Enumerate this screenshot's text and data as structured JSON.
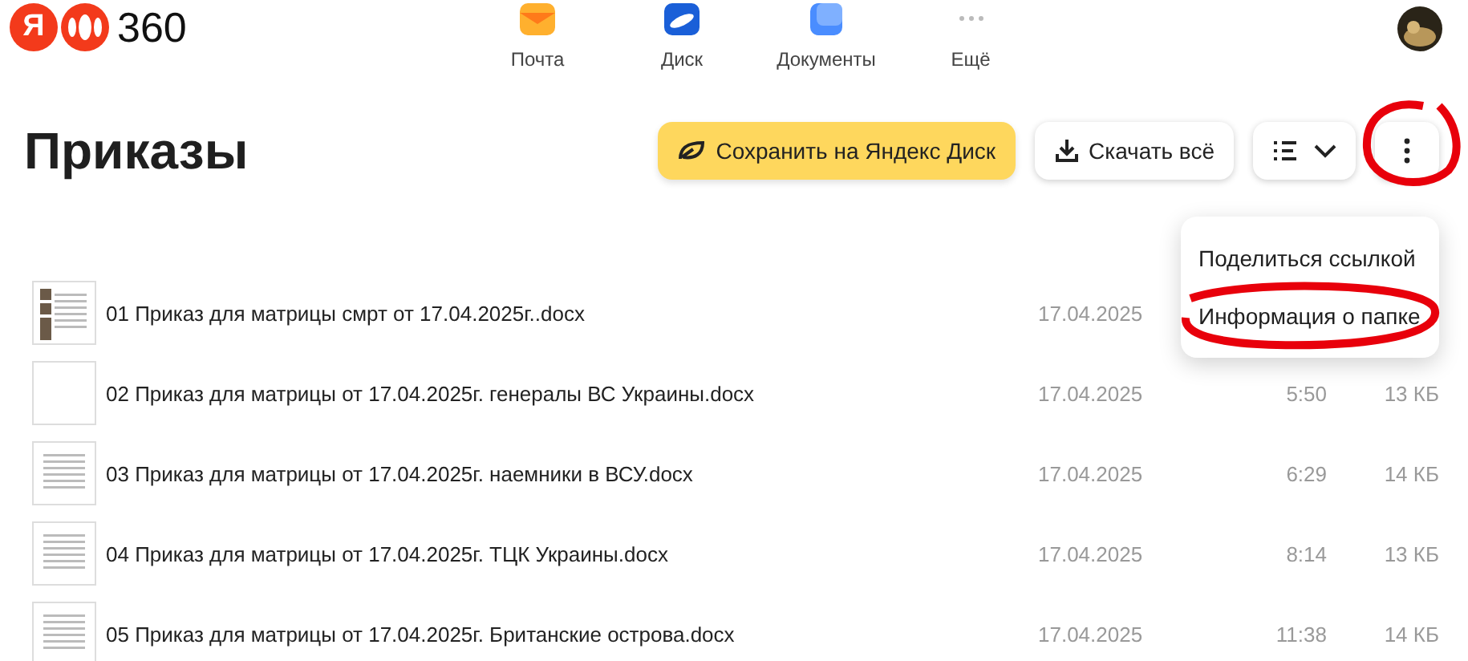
{
  "header": {
    "logo": {
      "letter": "Я",
      "name": "360"
    },
    "apps": [
      {
        "kind": "mail",
        "label": "Почта"
      },
      {
        "kind": "disk",
        "label": "Диск"
      },
      {
        "kind": "docs",
        "label": "Документы"
      },
      {
        "kind": "more",
        "label": "Ещё"
      }
    ]
  },
  "title": "Приказы",
  "toolbar": {
    "save_label": "Сохранить на Яндекс Диск",
    "download_label": "Скачать всё",
    "more_circled": true
  },
  "more_menu": {
    "open": true,
    "items": [
      {
        "label": "Поделиться ссылкой",
        "circled": false
      },
      {
        "label": "Информация о папке",
        "circled": true
      }
    ]
  },
  "files": [
    {
      "name": "01 Приказ для матрицы смрт от 17.04.2025г..docx",
      "date": "17.04.2025",
      "kind": "photos"
    },
    {
      "name": "02 Приказ для матрицы от 17.04.2025г. генералы ВС Украины.docx",
      "date": "17.04.2025",
      "time": "5:50",
      "size": "13 КБ",
      "kind": "blank"
    },
    {
      "name": "03 Приказ для матрицы от 17.04.2025г. наемники в ВСУ.docx",
      "date": "17.04.2025",
      "time": "6:29",
      "size": "14 КБ",
      "kind": "text"
    },
    {
      "name": "04 Приказ для матрицы от 17.04.2025г. ТЦК Украины.docx",
      "date": "17.04.2025",
      "time": "8:14",
      "size": "13 КБ",
      "kind": "text"
    },
    {
      "name": "05 Приказ для матрицы от 17.04.2025г. Британские острова.docx",
      "date": "17.04.2025",
      "time": "11:38",
      "size": "14 КБ",
      "kind": "text"
    }
  ]
}
